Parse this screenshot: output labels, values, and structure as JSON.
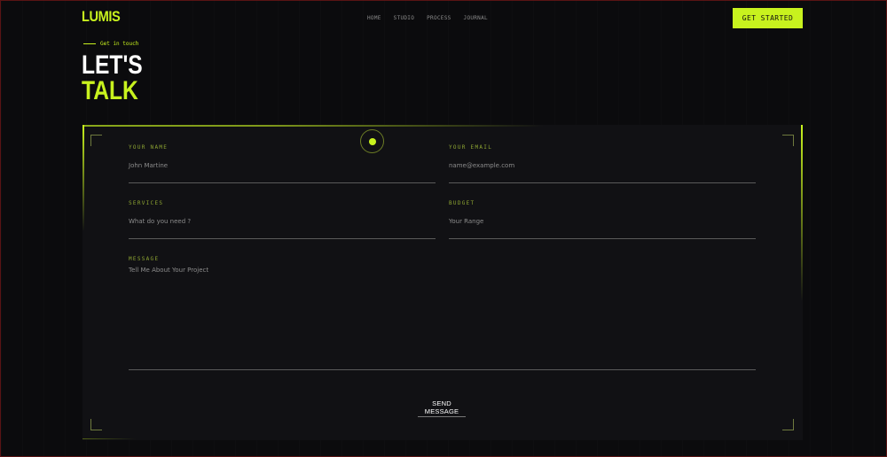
{
  "brand": {
    "logo": "LUMIS",
    "accent": "#c8f21e"
  },
  "nav": {
    "items": [
      "HOME",
      "STUDIO",
      "PROCESS",
      "JOURNAL"
    ],
    "cta_label": "GET STARTED"
  },
  "hero": {
    "eyebrow": "Get in touch",
    "line1": "LET'S",
    "line2": "TALK"
  },
  "form": {
    "name": {
      "label": "YOUR NAME",
      "placeholder": "John Martine"
    },
    "email": {
      "label": "YOUR EMAIL",
      "placeholder": "name@example.com"
    },
    "services": {
      "label": "SERVICES",
      "placeholder": "What do you need ?"
    },
    "budget": {
      "label": "BUDGET",
      "placeholder": "Your Range"
    },
    "message": {
      "label": "MESSAGE",
      "placeholder": "Tell Me About Your Project"
    },
    "submit_label": "SEND MESSAGE"
  },
  "icons": {
    "target": "target-dot-icon"
  }
}
